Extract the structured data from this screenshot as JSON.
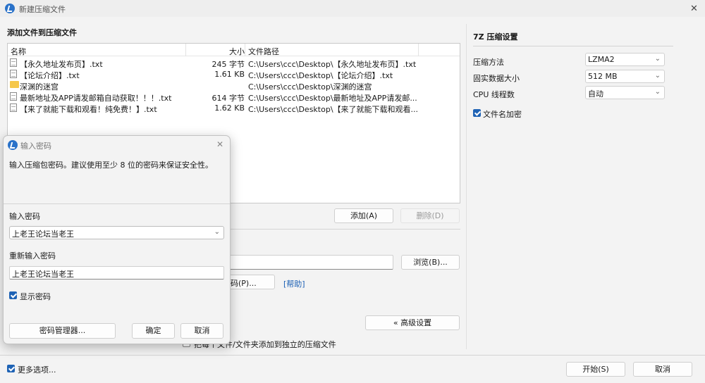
{
  "window": {
    "title": "新建压缩文件",
    "close_glyph": "✕"
  },
  "main": {
    "section_label": "添加文件到压缩文件",
    "columns": {
      "name": "名称",
      "size": "大小",
      "path": "文件路径"
    },
    "files": [
      {
        "name": "【永久地址发布页】.txt",
        "size": "245 字节",
        "path": "C:\\Users\\ccc\\Desktop\\【永久地址发布页】.txt",
        "icon": "text-file-icon"
      },
      {
        "name": "【论坛介绍】.txt",
        "size": "1.61 KB",
        "path": "C:\\Users\\ccc\\Desktop\\【论坛介绍】.txt",
        "icon": "text-file-icon"
      },
      {
        "name": "深渊的迷宫",
        "size": "",
        "path": "C:\\Users\\ccc\\Desktop\\深渊的迷宫",
        "icon": "folder-icon"
      },
      {
        "name": "最新地址及APP请发邮箱自动获取！！！.txt",
        "size": "614 字节",
        "path": "C:\\Users\\ccc\\Desktop\\最新地址及APP请发邮...",
        "icon": "text-file-icon"
      },
      {
        "name": "【来了就能下载和观看！纯免费！】.txt",
        "size": "1.62 KB",
        "path": "C:\\Users\\ccc\\Desktop\\【来了就能下载和观看...",
        "icon": "text-file-icon"
      }
    ],
    "add_button": "添加(A)",
    "delete_button": "删除(D)",
    "browse_button": "浏览(B)...",
    "password_button_partial": "码(P)...",
    "help_link": "[帮助]",
    "advanced_button": "« 高级设置",
    "bottom_option_partial": "把每个文件/文件夹添加到独立的压缩文件",
    "more_options_label": "更多选项...",
    "start_button": "开始(S)",
    "cancel_button": "取消"
  },
  "settings": {
    "title": "7Z 压缩设置",
    "method_label": "压缩方法",
    "method_value": "LZMA2",
    "dict_label": "固实数据大小",
    "dict_value": "512 MB",
    "threads_label": "CPU 线程数",
    "threads_value": "自动",
    "encrypt_names_label": "文件名加密",
    "encrypt_names_checked": true
  },
  "dialog": {
    "title": "输入密码",
    "message": "输入压缩包密码。建议使用至少 8 位的密码来保证安全性。",
    "password_label": "输入密码",
    "password_value": "上老王论坛当老王",
    "reenter_label": "重新输入密码",
    "reenter_value": "上老王论坛当老王",
    "show_password_label": "显示密码",
    "show_password_checked": true,
    "manager_button": "密码管理器...",
    "ok_button": "确定",
    "cancel_button": "取消"
  },
  "colors": {
    "accent": "#1f63b5",
    "link": "#1a5fb4",
    "folder": "#f6c84b"
  }
}
